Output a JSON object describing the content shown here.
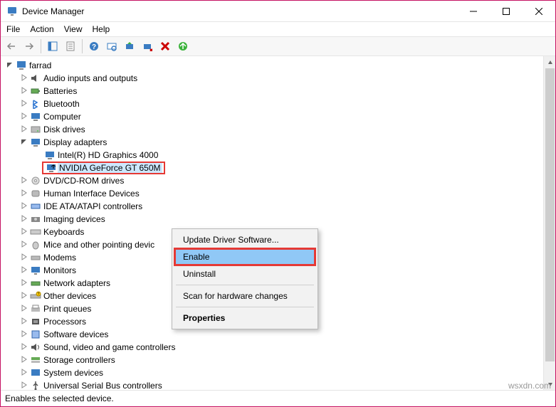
{
  "window": {
    "title": "Device Manager"
  },
  "menu": {
    "file": "File",
    "action": "Action",
    "view": "View",
    "help": "Help"
  },
  "root": {
    "label": "farrad"
  },
  "nodes": [
    {
      "key": "audio",
      "label": "Audio inputs and outputs",
      "expanded": false
    },
    {
      "key": "batteries",
      "label": "Batteries",
      "expanded": false
    },
    {
      "key": "bluetooth",
      "label": "Bluetooth",
      "expanded": false
    },
    {
      "key": "computer",
      "label": "Computer",
      "expanded": false
    },
    {
      "key": "disk",
      "label": "Disk drives",
      "expanded": false
    },
    {
      "key": "display",
      "label": "Display adapters",
      "expanded": true,
      "children": [
        {
          "key": "intel",
          "label": "Intel(R) HD Graphics 4000",
          "disabled": false
        },
        {
          "key": "nvidia",
          "label": "NVIDIA GeForce GT 650M",
          "disabled": true,
          "selected": true
        }
      ]
    },
    {
      "key": "dvd",
      "label": "DVD/CD-ROM drives",
      "expanded": false
    },
    {
      "key": "hid",
      "label": "Human Interface Devices",
      "expanded": false
    },
    {
      "key": "ide",
      "label": "IDE ATA/ATAPI controllers",
      "expanded": false
    },
    {
      "key": "imaging",
      "label": "Imaging devices",
      "expanded": false
    },
    {
      "key": "keyboards",
      "label": "Keyboards",
      "expanded": false
    },
    {
      "key": "mice",
      "label": "Mice and other pointing devic",
      "expanded": false
    },
    {
      "key": "modems",
      "label": "Modems",
      "expanded": false
    },
    {
      "key": "monitors",
      "label": "Monitors",
      "expanded": false
    },
    {
      "key": "network",
      "label": "Network adapters",
      "expanded": false
    },
    {
      "key": "other",
      "label": "Other devices",
      "expanded": false
    },
    {
      "key": "printq",
      "label": "Print queues",
      "expanded": false
    },
    {
      "key": "processors",
      "label": "Processors",
      "expanded": false
    },
    {
      "key": "software",
      "label": "Software devices",
      "expanded": false
    },
    {
      "key": "sound",
      "label": "Sound, video and game controllers",
      "expanded": false
    },
    {
      "key": "storage",
      "label": "Storage controllers",
      "expanded": false
    },
    {
      "key": "system",
      "label": "System devices",
      "expanded": false
    },
    {
      "key": "usb",
      "label": "Universal Serial Bus controllers",
      "expanded": false
    }
  ],
  "context_menu": {
    "update": "Update Driver Software...",
    "enable": "Enable",
    "uninstall": "Uninstall",
    "scan": "Scan for hardware changes",
    "properties": "Properties"
  },
  "status": "Enables the selected device.",
  "watermark": "wsxdn.com"
}
